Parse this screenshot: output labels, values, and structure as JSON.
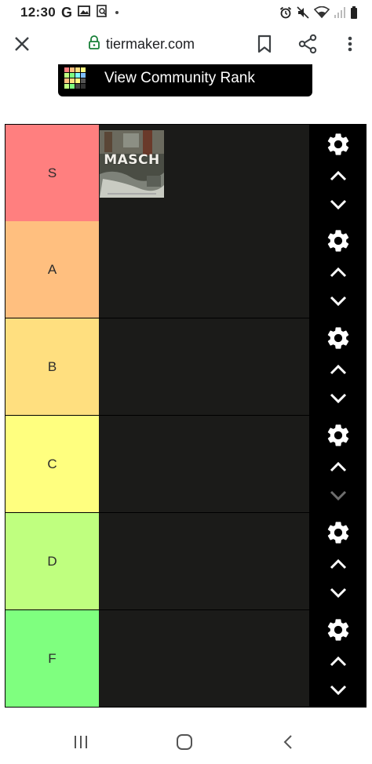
{
  "status_bar": {
    "time": "12:30",
    "g_letter": "G"
  },
  "browser": {
    "url": "tiermaker.com",
    "icons": [
      "close-icon",
      "lock-icon",
      "bookmark-icon",
      "share-icon",
      "more-vert-icon"
    ]
  },
  "community_button": {
    "label": "View Community Rank",
    "icon_colors": [
      "#ff7f7f",
      "#ffbf7f",
      "#ffdf7f",
      "#ffff7f",
      "#bfff7f",
      "#7fff7f",
      "#7fffff",
      "#7fbfff",
      "#ffbf7f",
      "#ffdf7f",
      "#ffff7f",
      "#555555",
      "#bfff7f",
      "#7fff7f",
      "#444444",
      "#333333"
    ]
  },
  "tiers": [
    {
      "label": "S",
      "color": "#ff7f7f",
      "down_enabled": true
    },
    {
      "label": "A",
      "color": "#ffbf7f",
      "down_enabled": true
    },
    {
      "label": "B",
      "color": "#ffdf7f",
      "down_enabled": true
    },
    {
      "label": "C",
      "color": "#ffff7f",
      "down_enabled": false
    },
    {
      "label": "D",
      "color": "#bfff7f",
      "down_enabled": true
    },
    {
      "label": "F",
      "color": "#7fff7f",
      "down_enabled": true
    }
  ],
  "tier_item": {
    "tier": "S",
    "album_text": "MASCH"
  },
  "controls": {
    "icons": [
      "gear-icon",
      "chevron-up-icon",
      "chevron-down-icon"
    ]
  },
  "nav_bar": {
    "icons": [
      "recents-icon",
      "home-icon",
      "back-icon"
    ]
  }
}
